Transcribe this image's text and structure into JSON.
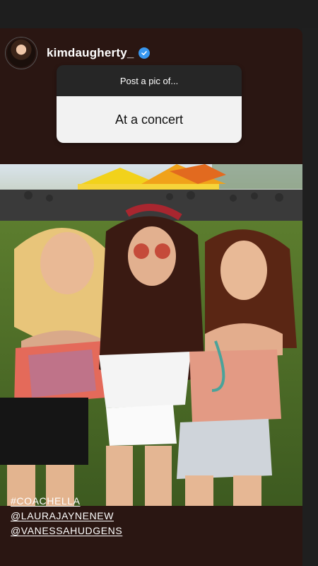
{
  "story": {
    "username": "kimdaugherty_",
    "verified_icon": "verified-badge-icon",
    "background_color": "#2a1612"
  },
  "question_sticker": {
    "prompt": "Post a pic of...",
    "answer": "At a concert"
  },
  "caption": {
    "tags": [
      "#COACHELLA",
      "@LAURAJAYNENEW",
      "@VANESSAHUDGENS"
    ]
  }
}
